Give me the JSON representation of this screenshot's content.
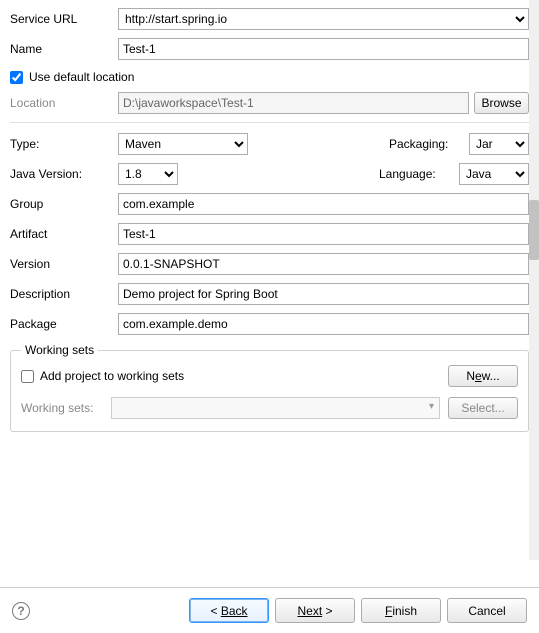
{
  "serviceUrl": {
    "label": "Service URL",
    "value": "http://start.spring.io"
  },
  "name": {
    "label": "Name",
    "value": "Test-1"
  },
  "useDefaultLocation": {
    "label": "Use default location",
    "checked": true
  },
  "location": {
    "label": "Location",
    "value": "D:\\javaworkspace\\Test-1",
    "browse": "Browse"
  },
  "type": {
    "label": "Type:",
    "value": "Maven"
  },
  "packaging": {
    "label": "Packaging:",
    "value": "Jar"
  },
  "javaVersion": {
    "label": "Java Version:",
    "value": "1.8"
  },
  "language": {
    "label": "Language:",
    "value": "Java"
  },
  "group": {
    "label": "Group",
    "value": "com.example"
  },
  "artifact": {
    "label": "Artifact",
    "value": "Test-1"
  },
  "version": {
    "label": "Version",
    "value": "0.0.1-SNAPSHOT"
  },
  "description": {
    "label": "Description",
    "value": "Demo project for Spring Boot"
  },
  "package": {
    "label": "Package",
    "value": "com.example.demo"
  },
  "workingSets": {
    "legend": "Working sets",
    "addLabel": "Add project to working sets",
    "addChecked": false,
    "newBtn": "New...",
    "comboLabel": "Working sets:",
    "selectBtn": "Select..."
  },
  "buttons": {
    "backPrefix": "< ",
    "back": "Back",
    "next": "Next",
    "nextSuffix": " >",
    "finish": "Finish",
    "cancel": "Cancel"
  }
}
